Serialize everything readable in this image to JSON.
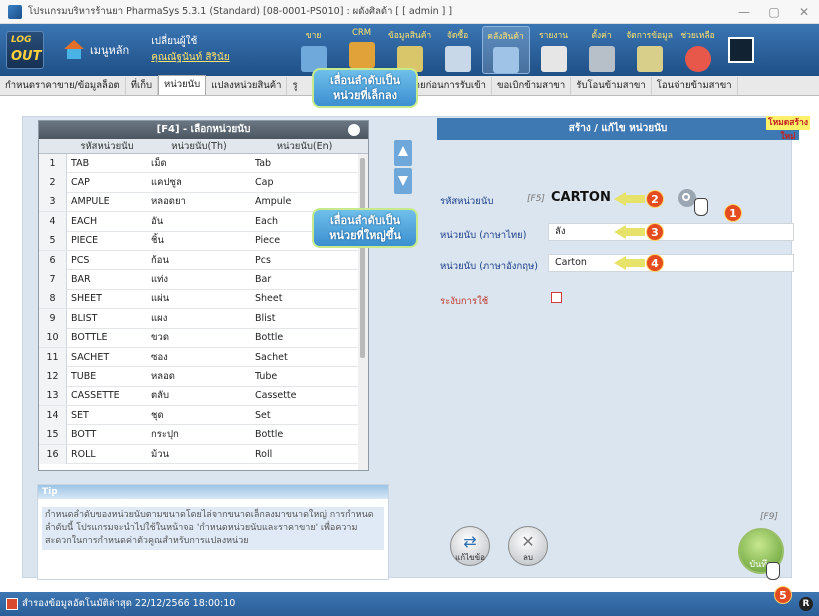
{
  "window": {
    "title": "โปรแกรมบริหารร้านยา PharmaSys 5.3.1 (Standard) [08-0001-PS010] : ผดังศิลด้า  [ [ admin ] ]",
    "minimize": "—",
    "maximize": "▢",
    "close": "✕"
  },
  "toolbar": {
    "logout_line1": "LOG",
    "logout_line2": "OUT",
    "main_menu": "เมนูหลัก",
    "change_user": "เปลี่ยนผู้ใช้",
    "user_name": "คุณณัฐนันท์ สิรินัย",
    "buttons": [
      {
        "label": "ขาย"
      },
      {
        "label": "CRM"
      },
      {
        "label": "ข้อมูลสินค้า"
      },
      {
        "label": "จัดซื้อ"
      },
      {
        "label": "คลังสินค้า"
      },
      {
        "label": "รายงาน"
      },
      {
        "label": "ตั้งค่า"
      },
      {
        "label": "จัดการข้อมูล"
      },
      {
        "label": "ช่วยเหลือ"
      }
    ]
  },
  "tabs": [
    "กำหนดราคาขาย/ข้อมูลล็อต",
    "ที่เก็บ",
    "หน่วยนับ",
    "แปลงหน่วยสินค้า",
    "รู",
    "กขายก่อนการรับเข้า",
    "ขอเบิกข้ามสาขา",
    "รับโอนข้ามสาขา",
    "โอนจ่ายข้ามสาขา"
  ],
  "unit_table": {
    "header": "[F4] - เลือกหน่วยนับ",
    "columns": [
      "รหัสหน่วยนับ",
      "หน่วยนับ(Th)",
      "หน่วยนับ(En)"
    ],
    "rows": [
      {
        "no": "1",
        "code": "TAB",
        "th": "เม็ด",
        "en": "Tab"
      },
      {
        "no": "2",
        "code": "CAP",
        "th": "แคปซูล",
        "en": "Cap"
      },
      {
        "no": "3",
        "code": "AMPULE",
        "th": "หลอดยา",
        "en": "Ampule"
      },
      {
        "no": "4",
        "code": "EACH",
        "th": "อัน",
        "en": "Each"
      },
      {
        "no": "5",
        "code": "PIECE",
        "th": "ชิ้น",
        "en": "Piece"
      },
      {
        "no": "6",
        "code": "PCS",
        "th": "ก้อน",
        "en": "Pcs"
      },
      {
        "no": "7",
        "code": "BAR",
        "th": "แท่ง",
        "en": "Bar"
      },
      {
        "no": "8",
        "code": "SHEET",
        "th": "แผ่น",
        "en": "Sheet"
      },
      {
        "no": "9",
        "code": "BLIST",
        "th": "แผง",
        "en": "Blist"
      },
      {
        "no": "10",
        "code": "BOTTLE",
        "th": "ขวด",
        "en": "Bottle"
      },
      {
        "no": "11",
        "code": "SACHET",
        "th": "ซอง",
        "en": "Sachet"
      },
      {
        "no": "12",
        "code": "TUBE",
        "th": "หลอด",
        "en": "Tube"
      },
      {
        "no": "13",
        "code": "CASSETTE",
        "th": "ตลับ",
        "en": "Cassette"
      },
      {
        "no": "14",
        "code": "SET",
        "th": "ชุด",
        "en": "Set"
      },
      {
        "no": "15",
        "code": "BOTT",
        "th": "กระปุก",
        "en": "Bottle"
      },
      {
        "no": "16",
        "code": "ROLL",
        "th": "ม้วน",
        "en": "Roll"
      }
    ]
  },
  "callouts": {
    "smaller_line1": "เลื่อนลำดับเป็น",
    "smaller_line2": "หน่วยที่เล็กลง",
    "larger_line1": "เลื่อนลำดับเป็น",
    "larger_line2": "หน่วยที่ใหญ่ขึ้น"
  },
  "form": {
    "header": "สร้าง / แก้ไข หน่วยนับ",
    "mode_badge": "โหมดสร้างใหม่",
    "code_label": "รหัสหน่วยนับ",
    "code_hint": "[F5]",
    "code_value": "CARTON",
    "thai_label": "หน่วยนับ (ภาษาไทย)",
    "thai_value": "ลัง",
    "eng_label": "หน่วยนับ (ภาษาอังกฤษ)",
    "eng_value": "Carton",
    "suspend_label": "ระงับการใช้"
  },
  "steps": [
    "1",
    "2",
    "3",
    "4",
    "5"
  ],
  "tip": {
    "title": "Tip",
    "text": "กำหนดลำดับของหน่วยนับตามขนาดโดยไล่จากขนาดเล็กลงมาขนาดใหญ่ การกำหนดลำดับนี้ โปรแกรมจะนำไปใช้ในหน้าจอ 'กำหนดหน่วยนับและราคาขาย' เพื่อความสะดวกในการกำหนดค่าตัวคูณสำหรับการแปลงหน่วย"
  },
  "actions": {
    "clear_label": "แก้ไขข้อ",
    "delete_label": "ลบ",
    "save_label": "บันทึก",
    "save_hint": "[F9]"
  },
  "status": {
    "text": "สำรองข้อมูลอัตโนมัติล่าสุด  22/12/2566 18:00:10",
    "badge": "R"
  }
}
